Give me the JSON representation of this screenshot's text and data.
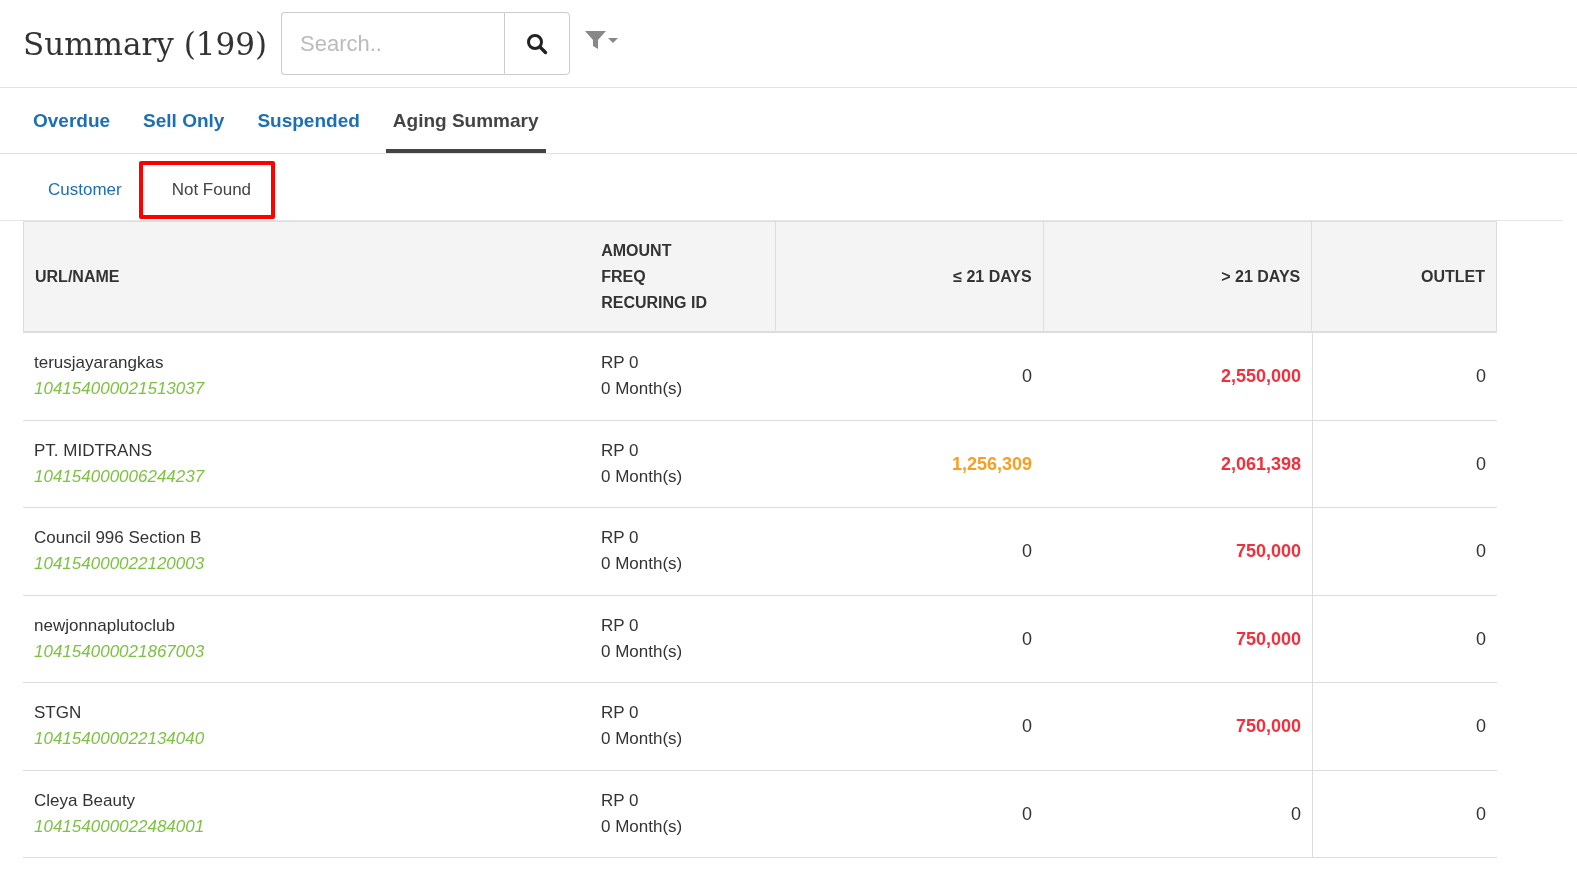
{
  "header": {
    "title": "Summary (199)",
    "search": {
      "placeholder": "Search.."
    }
  },
  "tabs": [
    {
      "label": "Overdue",
      "selected": false
    },
    {
      "label": "Sell Only",
      "selected": false
    },
    {
      "label": "Suspended",
      "selected": false
    },
    {
      "label": "Aging Summary",
      "selected": true
    }
  ],
  "subtabs": [
    {
      "label": "Customer",
      "selected": false,
      "highlighted": false
    },
    {
      "label": "Not Found",
      "selected": true,
      "highlighted": true
    }
  ],
  "table": {
    "columns": [
      [
        "URL/NAME"
      ],
      [
        "AMOUNT",
        "FREQ",
        "RECURING ID"
      ],
      [
        "≤ 21 DAYS"
      ],
      [
        "> 21 DAYS"
      ],
      [
        "OUTLET"
      ]
    ],
    "rows": [
      {
        "name": "terusjayarangkas",
        "id": "104154000021513037",
        "amount": "RP 0",
        "freq": "0 Month(s)",
        "d21": {
          "value": "0",
          "color": "#333333",
          "bold": false
        },
        "over21": {
          "value": "2,550,000",
          "color": "#f0303c",
          "bold": true
        },
        "outlet": "0"
      },
      {
        "name": "PT. MIDTRANS",
        "id": "104154000006244237",
        "amount": "RP 0",
        "freq": "0 Month(s)",
        "d21": {
          "value": "1,256,309",
          "color": "#f5a023",
          "bold": true
        },
        "over21": {
          "value": "2,061,398",
          "color": "#f0303c",
          "bold": true
        },
        "outlet": "0"
      },
      {
        "name": "Council 996 Section B",
        "id": "104154000022120003",
        "amount": "RP 0",
        "freq": "0 Month(s)",
        "d21": {
          "value": "0",
          "color": "#333333",
          "bold": false
        },
        "over21": {
          "value": "750,000",
          "color": "#f0303c",
          "bold": true
        },
        "outlet": "0"
      },
      {
        "name": "newjonnaplutoclub",
        "id": "104154000021867003",
        "amount": "RP 0",
        "freq": "0 Month(s)",
        "d21": {
          "value": "0",
          "color": "#333333",
          "bold": false
        },
        "over21": {
          "value": "750,000",
          "color": "#f0303c",
          "bold": true
        },
        "outlet": "0"
      },
      {
        "name": "STGN",
        "id": "104154000022134040",
        "amount": "RP 0",
        "freq": "0 Month(s)",
        "d21": {
          "value": "0",
          "color": "#333333",
          "bold": false
        },
        "over21": {
          "value": "750,000",
          "color": "#f0303c",
          "bold": true
        },
        "outlet": "0"
      },
      {
        "name": "Cleya Beauty",
        "id": "104154000022484001",
        "amount": "RP 0",
        "freq": "0 Month(s)",
        "d21": {
          "value": "0",
          "color": "#333333",
          "bold": false
        },
        "over21": {
          "value": "0",
          "color": "#333333",
          "bold": false
        },
        "outlet": "0"
      }
    ]
  }
}
